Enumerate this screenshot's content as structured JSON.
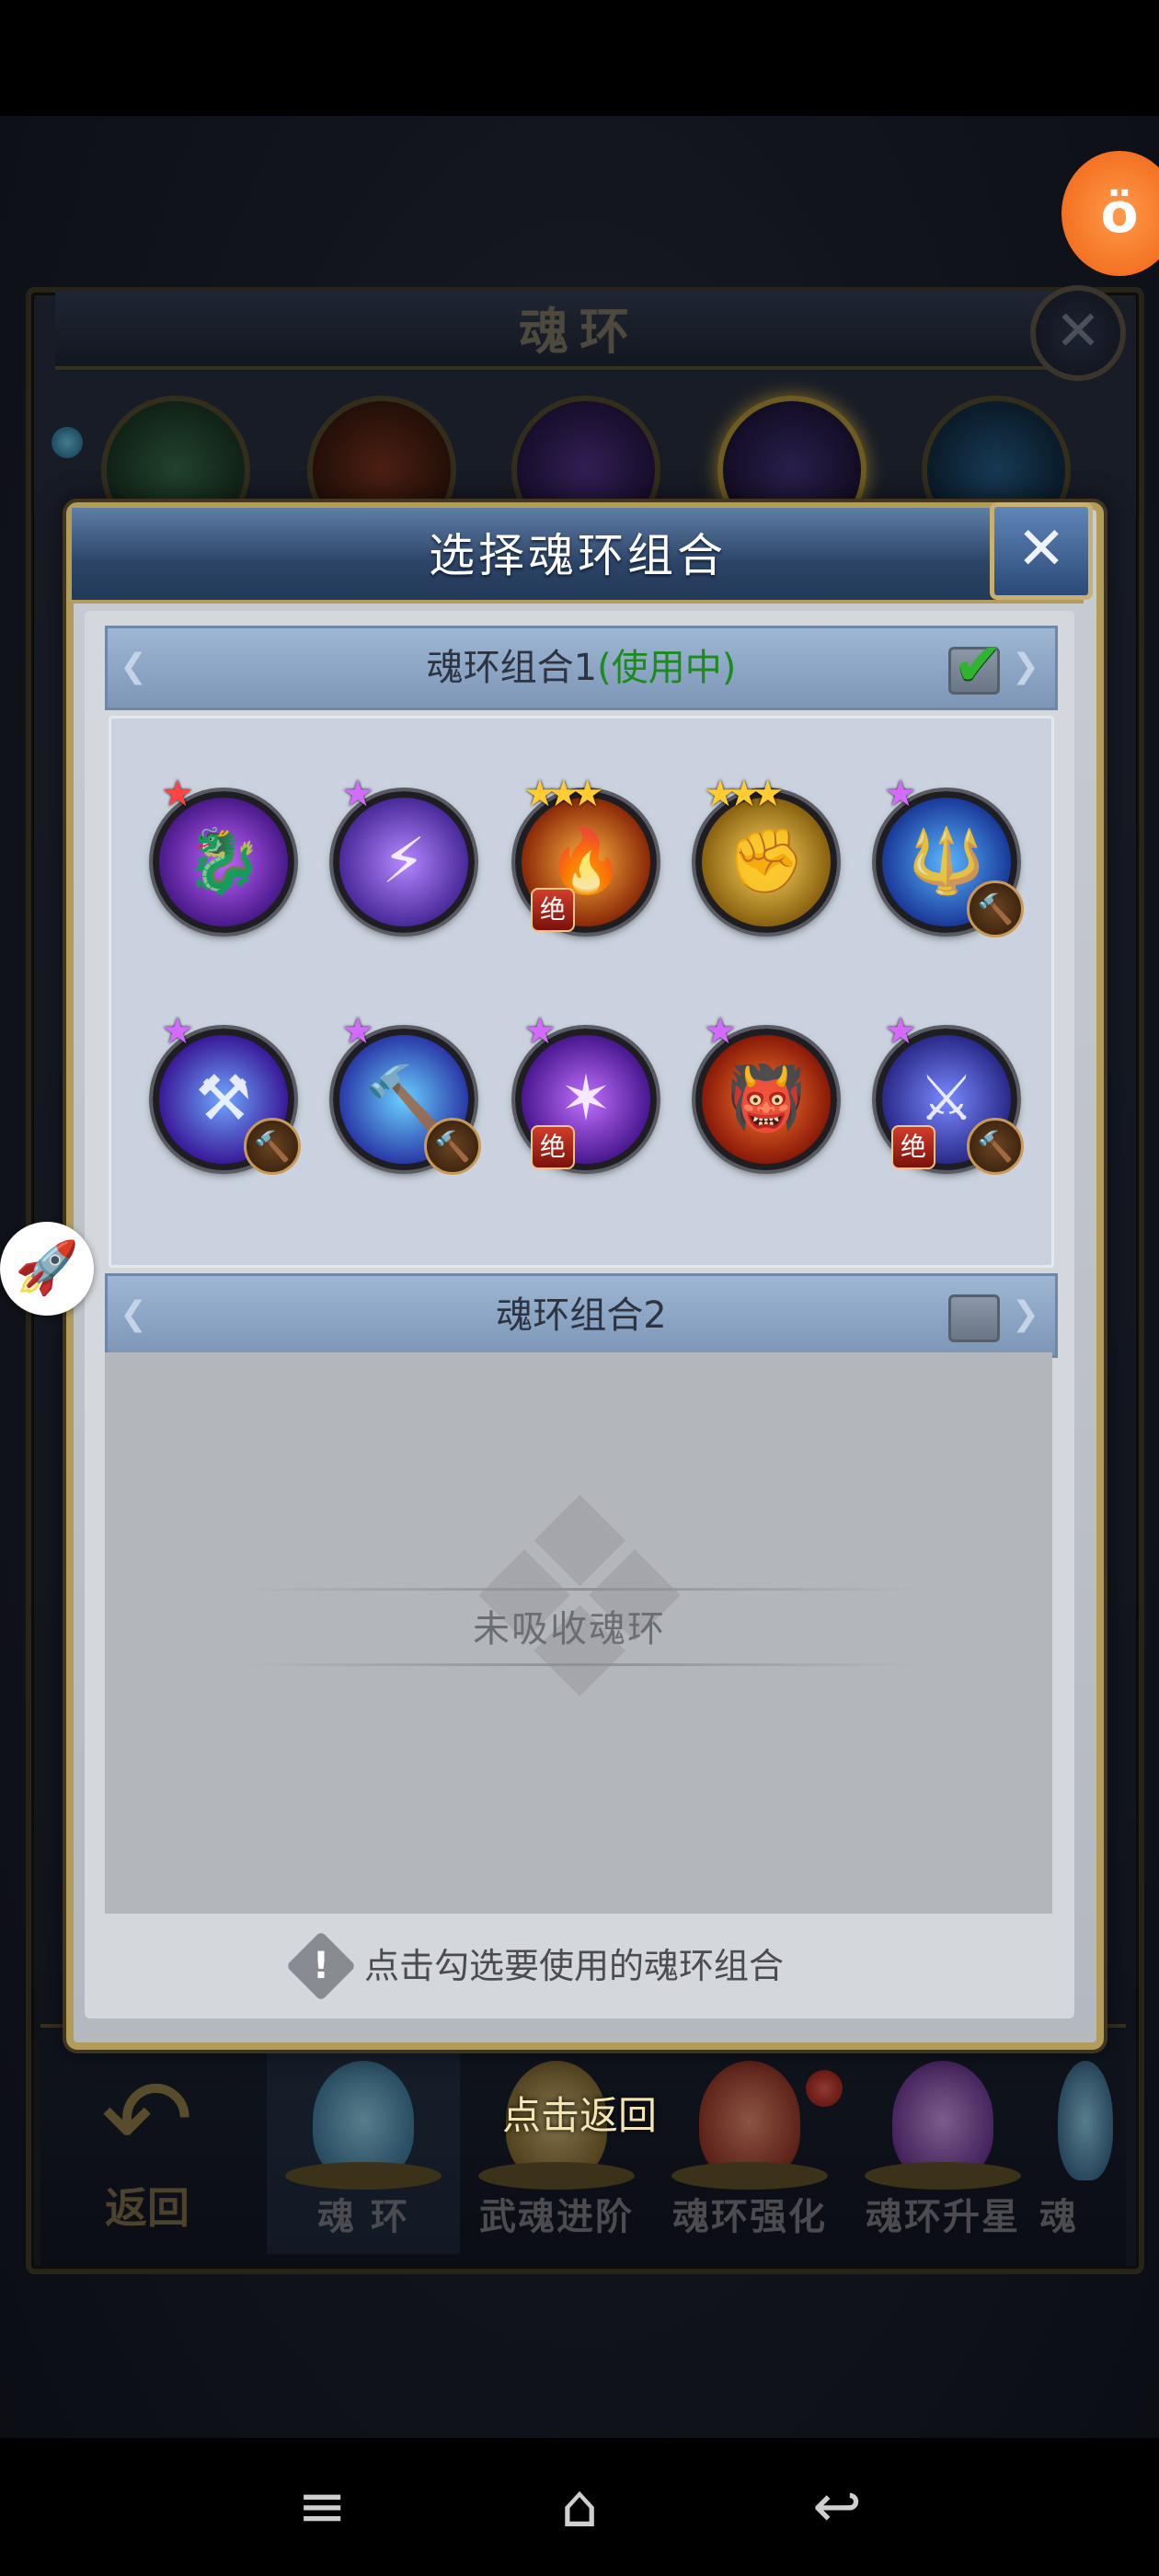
{
  "game": {
    "page_title": "魂环",
    "close_glyph": "✕",
    "bottom_nav": {
      "back_label": "返回",
      "tabs": [
        {
          "label": "魂 环"
        },
        {
          "label": "武魂进阶"
        },
        {
          "label": "魂环强化"
        },
        {
          "label": "魂环升星"
        },
        {
          "label": "魂"
        }
      ],
      "tap_return_hint": "点击返回"
    }
  },
  "dialog": {
    "title": "选择魂环组合",
    "close_glyph": "✕",
    "combo1": {
      "name": "魂环组合1",
      "status": "(使用中)",
      "checked": true,
      "rings": [
        {
          "stars": "★",
          "star_color": "#ff4444",
          "icon": "dragon-icon",
          "glyph": "🐉",
          "bg": "radial-gradient(#c063ff,#4a1a8a 70%,#1a0a30)",
          "badges": []
        },
        {
          "stars": "★",
          "star_color": "#d46bff",
          "icon": "lightning-icon",
          "glyph": "⚡",
          "bg": "radial-gradient(#b488ff,#4a2a9a 70%,#180a3a)",
          "badges": []
        },
        {
          "stars": "★★★",
          "star_color": "#ffcc33",
          "icon": "fire-beast-icon",
          "glyph": "🔥",
          "bg": "radial-gradient(#ffb040,#8a2a08 70%,#2a0a00)",
          "badges": [
            "jue"
          ]
        },
        {
          "stars": "★★★",
          "star_color": "#ffcc33",
          "icon": "golden-fist-icon",
          "glyph": "✊",
          "bg": "radial-gradient(#ffd860,#8a6210 70%,#2a1a00)",
          "badges": []
        },
        {
          "stars": "★",
          "star_color": "#d46bff",
          "icon": "trident-icon",
          "glyph": "🔱",
          "bg": "radial-gradient(#5ab6ff,#1a3a9a 70%,#081030)",
          "badges": [
            "hammer"
          ]
        },
        {
          "stars": "★",
          "star_color": "#d46bff",
          "icon": "hammer-strike-icon",
          "glyph": "⚒",
          "bg": "radial-gradient(#6fa8ff,#3a1a9a 70%,#100830)",
          "badges": [
            "hammer"
          ]
        },
        {
          "stars": "★",
          "star_color": "#d46bff",
          "icon": "war-hammer-icon",
          "glyph": "🔨",
          "bg": "radial-gradient(#6ad0ff,#2a3aa8 70%,#0a1030)",
          "badges": [
            "hammer"
          ]
        },
        {
          "stars": "★",
          "star_color": "#d46bff",
          "icon": "claw-icon",
          "glyph": "✶",
          "bg": "radial-gradient(#c070ff,#4a1890 70%,#14062a)",
          "badges": [
            "jue"
          ]
        },
        {
          "stars": "★",
          "star_color": "#d46bff",
          "icon": "flame-warrior-icon",
          "glyph": "👹",
          "bg": "radial-gradient(#ff7a30,#8a1a08 70%,#2a0600)",
          "badges": []
        },
        {
          "stars": "★",
          "star_color": "#d46bff",
          "icon": "shadow-warrior-icon",
          "glyph": "⚔",
          "bg": "radial-gradient(#7a8aff,#2a2a8a 70%,#0a0a2a)",
          "badges": [
            "jue",
            "hammer"
          ]
        }
      ]
    },
    "combo2": {
      "name": "魂环组合2",
      "checked": false,
      "empty_text": "未吸收魂环"
    },
    "hint_text": "点击勾选要使用的魂环组合",
    "badge_jue_text": "绝",
    "badge_hammer_glyph": "🔨",
    "checkmark_glyph": "✔"
  },
  "widgets": {
    "float_top_glyph": "ö",
    "float_left_glyph": "🚀"
  },
  "system_nav": {
    "menu_glyph": "≡",
    "home_glyph": "⌂",
    "back_glyph": "↩"
  }
}
